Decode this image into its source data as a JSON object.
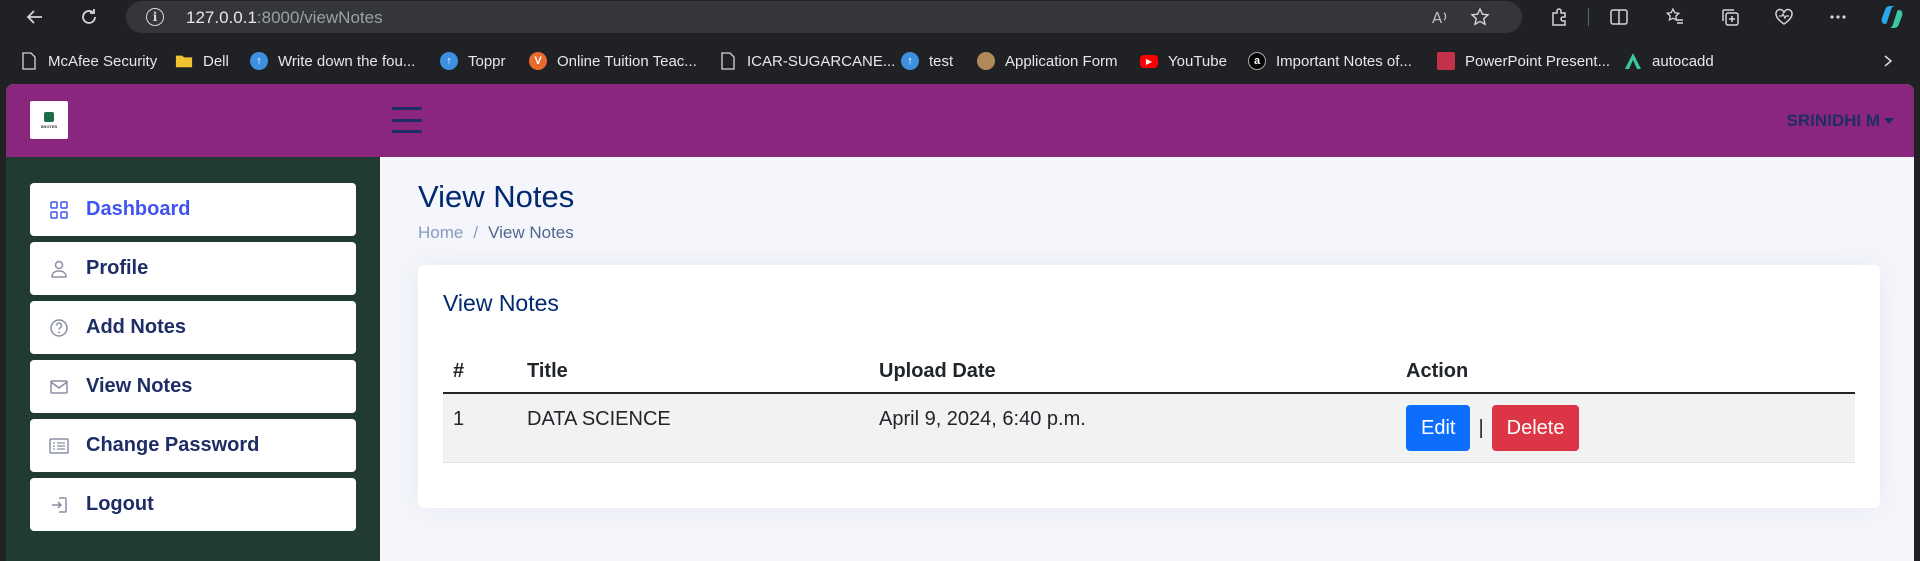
{
  "browser": {
    "url_host": "127.0.0.1",
    "url_rest": ":8000/viewNotes",
    "bookmarks": [
      {
        "label": "McAfee Security",
        "icon": "shield-icon",
        "color": "#c01818"
      },
      {
        "label": "Dell",
        "icon": "folder-icon",
        "color": "#f1c232"
      },
      {
        "label": "Write down the fou...",
        "icon": "upload-icon",
        "color": "#3d8fe0"
      },
      {
        "label": "Toppr",
        "icon": "upload-icon",
        "color": "#3d8fe0"
      },
      {
        "label": "Online Tuition Teac...",
        "icon": "v-icon",
        "color": "#e86a2c"
      },
      {
        "label": "ICAR-SUGARCANE...",
        "icon": "document-icon",
        "color": "#e8e8e8"
      },
      {
        "label": "test",
        "icon": "upload-icon",
        "color": "#3d8fe0"
      },
      {
        "label": "Application Form",
        "icon": "seal-icon",
        "color": "#b08a5a"
      },
      {
        "label": "YouTube",
        "icon": "youtube-icon",
        "color": "#ff0000"
      },
      {
        "label": "Important Notes of...",
        "icon": "a-icon",
        "color": "#000000"
      },
      {
        "label": "PowerPoint Present...",
        "icon": "ppt-icon",
        "color": "#c4314b"
      },
      {
        "label": "autocadd",
        "icon": "autocad-icon",
        "color": "#e8e8e8"
      }
    ]
  },
  "header": {
    "logo_text": "SNOTES",
    "user_name": "SRINIDHI M"
  },
  "sidebar": {
    "items": [
      {
        "label": "Dashboard",
        "icon": "grid-icon",
        "active": true
      },
      {
        "label": "Profile",
        "icon": "person-icon",
        "active": false
      },
      {
        "label": "Add Notes",
        "icon": "question-circle-icon",
        "active": false
      },
      {
        "label": "View Notes",
        "icon": "envelope-icon",
        "active": false
      },
      {
        "label": "Change Password",
        "icon": "list-icon",
        "active": false
      },
      {
        "label": "Logout",
        "icon": "logout-icon",
        "active": false
      }
    ]
  },
  "main": {
    "page_title": "View Notes",
    "breadcrumb": {
      "home": "Home",
      "sep": "/",
      "current": "View Notes"
    },
    "card_title": "View Notes",
    "table": {
      "headers": [
        "#",
        "Title",
        "Upload Date",
        "Action"
      ],
      "rows": [
        {
          "num": "1",
          "title": "DATA SCIENCE",
          "date": "April 9, 2024, 6:40 p.m."
        }
      ],
      "edit_label": "Edit",
      "pipe": "|",
      "delete_label": "Delete"
    }
  },
  "colors": {
    "header_bg": "#8b267e",
    "sidebar_bg": "#213b33",
    "title_color": "#012970",
    "edit_btn": "#0d6efd",
    "delete_btn": "#dc3545"
  }
}
